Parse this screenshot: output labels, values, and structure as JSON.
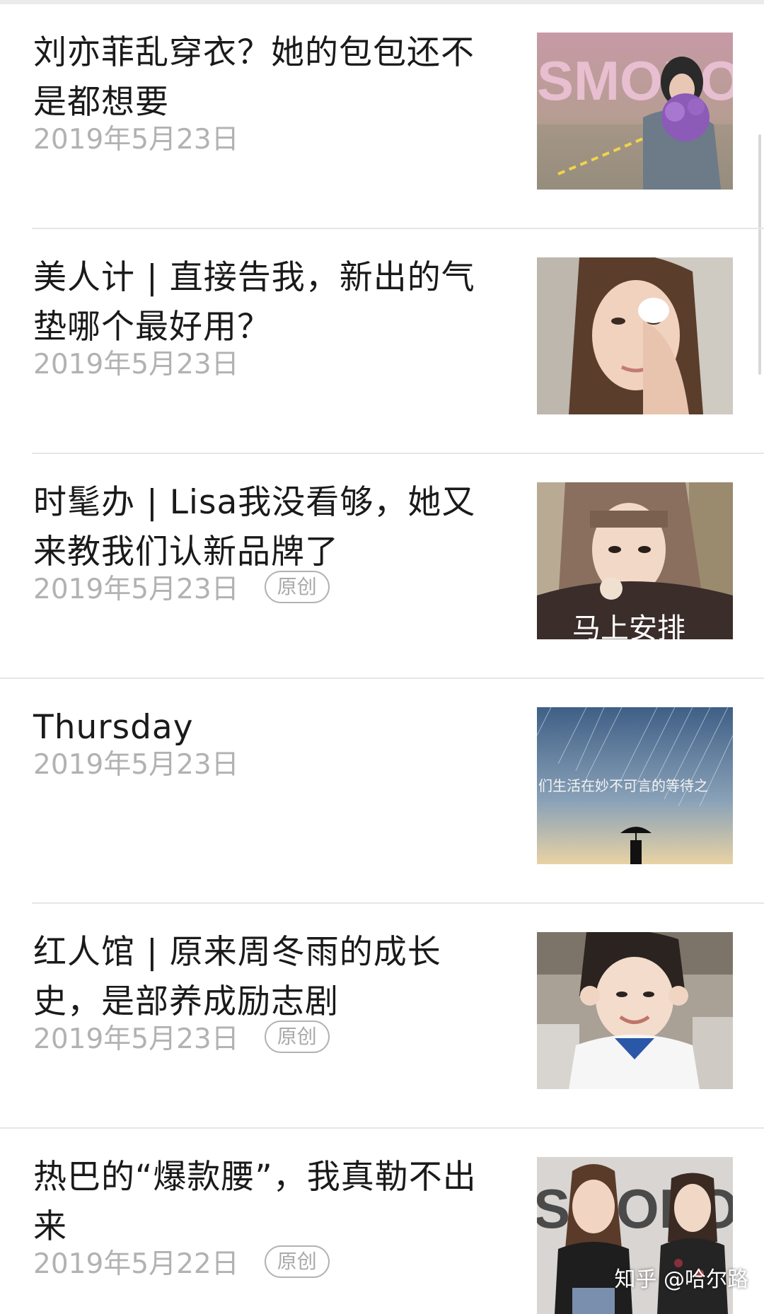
{
  "articles": [
    {
      "title": "刘亦菲乱穿衣？她的包包还不是都想要",
      "date": "2019年5月23日",
      "badge": "",
      "thumb_text": "SMOPOLIT",
      "thumb_icon": "portrait-with-flowers-photo"
    },
    {
      "title": "美人计 | 直接告我，新出的气垫哪个最好用？",
      "date": "2019年5月23日",
      "badge": "",
      "thumb_icon": "woman-applying-cushion-photo"
    },
    {
      "title": "时髦办 | Lisa我没看够，她又来教我们认新品牌了",
      "date": "2019年5月23日",
      "badge": "原创",
      "thumb_text": "马上安排",
      "thumb_icon": "lisa-portrait-photo"
    },
    {
      "title": "Thursday",
      "date": "2019年5月23日",
      "badge": "",
      "thumb_text": "们生活在妙不可言的等待之",
      "thumb_icon": "sky-umbrella-photo"
    },
    {
      "title": "红人馆 | 原来周冬雨的成长史，是部养成励志剧",
      "date": "2019年5月23日",
      "badge": "原创",
      "thumb_icon": "girl-peace-sign-photo"
    },
    {
      "title": "热巴的“爆款腰”，我真勒不出来",
      "date": "2019年5月22日",
      "badge": "原创",
      "thumb_text": "SMOPOLIT",
      "thumb_icon": "two-women-magazine-photo"
    }
  ],
  "watermark": "知乎 @哈尔路"
}
